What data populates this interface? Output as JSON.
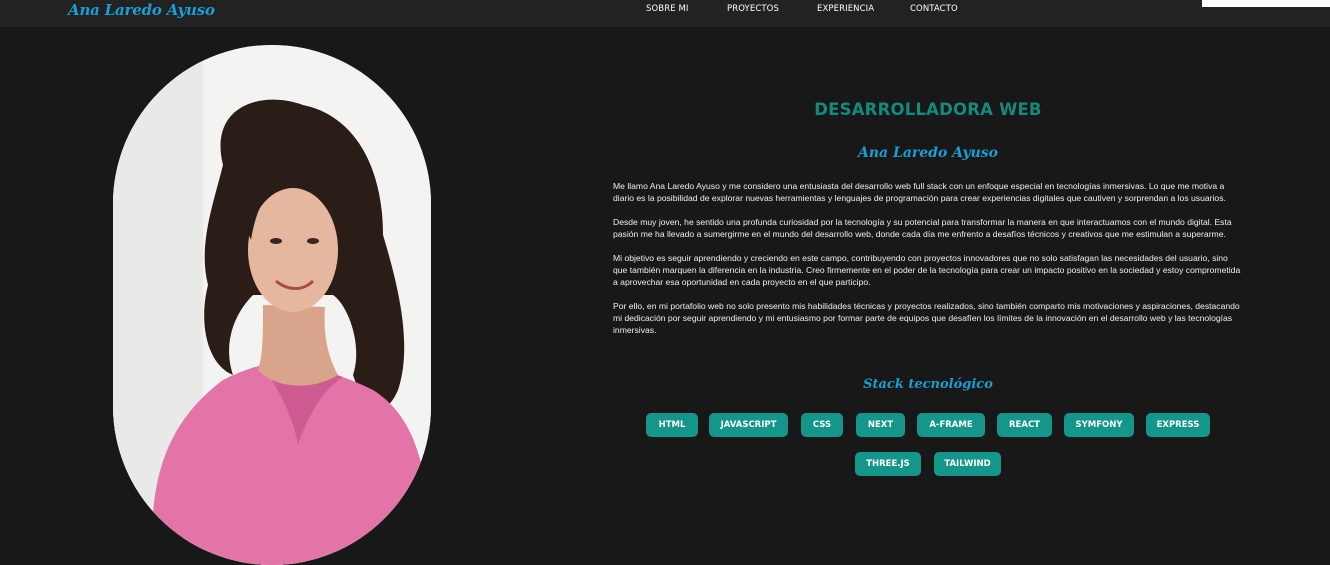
{
  "navbar": {
    "brand": "Ana Laredo Ayuso",
    "links": [
      "SOBRE MI",
      "PROYECTOS",
      "EXPERIENCIA",
      "CONTACTO"
    ]
  },
  "about": {
    "role": "DESARROLLADORA WEB",
    "name": "Ana Laredo Ayuso",
    "paragraphs": [
      "Me llamo Ana Laredo Ayuso y me considero una entusiasta del desarrollo web full stack con un enfoque especial en tecnologías inmersivas. Lo que me motiva a diario es la posibilidad de explorar nuevas herramientas y lenguajes de programación para crear experiencias digitales que cautiven y sorprendan a los usuarios.",
      "Desde muy joven, he sentido una profunda curiosidad por la tecnología y su potencial para transformar la manera en que interactuamos con el mundo digital. Esta pasión me ha llevado a sumergirme en el mundo del desarrollo web, donde cada día me enfrento a desafíos técnicos y creativos que me estimulan a superarme.",
      "Mi objetivo es seguir aprendiendo y creciendo en este campo, contribuyendo con proyectos innovadores que no solo satisfagan las necesidades del usuario, sino que también marquen la diferencia en la industria. Creo firmemente en el poder de la tecnología para crear un impacto positivo en la sociedad y estoy comprometida a aprovechar esa oportunidad en cada proyecto en el que participo.",
      "Por ello, en mi portafolio web no solo presento mis habilidades técnicas y proyectos realizados, sino también comparto mis motivaciones y aspiraciones, destacando mi dedicación por seguir aprendiendo y mi entusiasmo por formar parte de equipos que desafíen los límites de la innovación en el desarrollo web y las tecnologías inmersivas."
    ]
  },
  "stack": {
    "title": "Stack tecnológico",
    "items": [
      "HTML",
      "JAVASCRIPT",
      "CSS",
      "NEXT",
      "A-FRAME",
      "REACT",
      "SYMFONY",
      "EXPRESS",
      "THREE.JS",
      "TAILWIND"
    ]
  },
  "colors": {
    "background": "#181818",
    "navbar": "#222222",
    "accent_blue": "#1a9fd4",
    "accent_teal": "#148a7c",
    "chip": "#14968a"
  }
}
